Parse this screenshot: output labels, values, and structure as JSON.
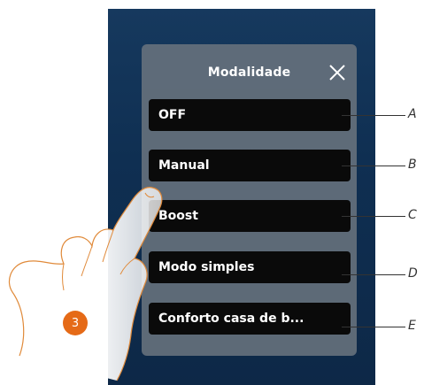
{
  "panel": {
    "title": "Modalidade",
    "close_icon": "close-icon",
    "options": [
      {
        "label": "OFF",
        "callout": "A"
      },
      {
        "label": "Manual",
        "callout": "B"
      },
      {
        "label": "Boost",
        "callout": "C"
      },
      {
        "label": "Modo simples",
        "callout": "D"
      },
      {
        "label": "Conforto casa de b...",
        "callout": "E"
      }
    ]
  },
  "step_badge": "3",
  "colors": {
    "panel_bg": "#69737d",
    "option_bg": "#0a0a0a",
    "screen_bg": "#16395e",
    "badge": "#e56a17"
  }
}
